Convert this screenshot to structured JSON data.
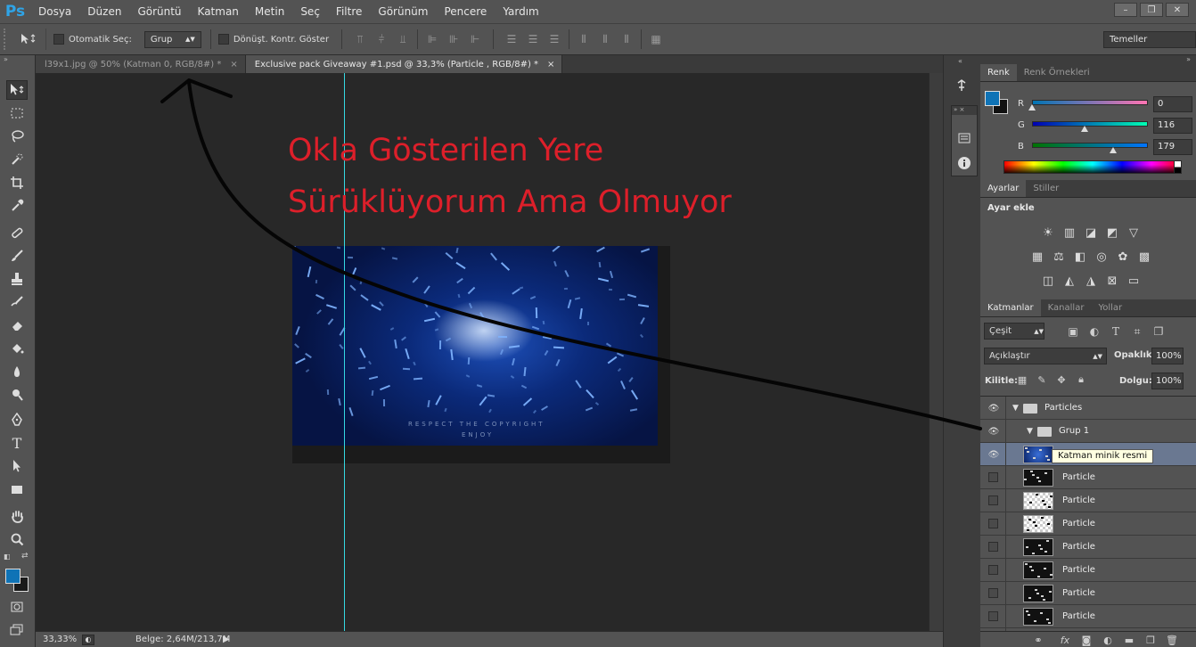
{
  "app": {
    "logo": "Ps"
  },
  "menu": [
    "Dosya",
    "Düzen",
    "Görüntü",
    "Katman",
    "Metin",
    "Seç",
    "Filtre",
    "Görünüm",
    "Pencere",
    "Yardım"
  ],
  "window_controls": {
    "minimize": "–",
    "restore": "❐",
    "close": "✕"
  },
  "options": {
    "auto_select_label": "Otomatik Seç:",
    "auto_select_target": "Grup",
    "show_transform_label": "Dönüşt. Kontr. Göster",
    "workspace": "Temeller"
  },
  "tabs": [
    {
      "label": "l39x1.jpg @ 50% (Katman 0, RGB/8#) *",
      "close": "×"
    },
    {
      "label": "Exclusive pack Giveaway #1.psd @ 33,3% (Particle , RGB/8#) *",
      "close": "×"
    }
  ],
  "annotation": {
    "line1": "Okla Gösterilen  Yere",
    "line2": "Sürüklüyorum Ama Olmuyor",
    "color": "#dd1f2a"
  },
  "document_image": {
    "text1": "RESPECT THE COPYRIGHT",
    "text2": "ENJOY"
  },
  "status": {
    "zoom": "33,33%",
    "doc_info": "Belge: 2,64M/213,7M"
  },
  "colors": {
    "foreground": "#0f73b6",
    "background": "#111111",
    "guide": "#35d9e3"
  },
  "color_panel": {
    "tabs": [
      "Renk",
      "Renk Örnekleri"
    ],
    "r_label": "R",
    "g_label": "G",
    "b_label": "B",
    "r": 0,
    "g": 116,
    "b": 179
  },
  "adjustments": {
    "tabs": [
      "Ayarlar",
      "Stiller"
    ],
    "title": "Ayar ekle"
  },
  "layers_panel": {
    "tabs": [
      "Katmanlar",
      "Kanallar",
      "Yollar"
    ],
    "filter": "Çeşit",
    "blend_mode": "Açıklaştır",
    "opacity_label": "Opaklık:",
    "opacity": "100%",
    "lock_label": "Kilitle:",
    "fill_label": "Dolgu:",
    "fill": "100%",
    "tooltip": "Katman minik resmi",
    "footer_link_label": "fx"
  },
  "layers": [
    {
      "name": "Particles",
      "kind": "group",
      "visible": true,
      "level": 0
    },
    {
      "name": "Grup 1",
      "kind": "group",
      "visible": true,
      "level": 1
    },
    {
      "name": "Particle",
      "kind": "layer",
      "visible": true,
      "selected": true
    },
    {
      "name": "Particle",
      "kind": "layer",
      "visible": false
    },
    {
      "name": "Particle",
      "kind": "layer",
      "visible": false
    },
    {
      "name": "Particle",
      "kind": "layer",
      "visible": false
    },
    {
      "name": "Particle",
      "kind": "layer",
      "visible": false
    },
    {
      "name": "Particle",
      "kind": "layer",
      "visible": false
    },
    {
      "name": "Particle",
      "kind": "layer",
      "visible": false
    },
    {
      "name": "Particle",
      "kind": "layer",
      "visible": false
    },
    {
      "name": "Particle",
      "kind": "layer",
      "visible": true
    }
  ],
  "icons": {
    "move": "move-icon",
    "marquee": "marquee-icon",
    "lasso": "lasso-icon",
    "quick-select": "quick-select-icon",
    "crop": "crop-icon",
    "eyedropper": "eyedropper-icon",
    "healing": "healing-brush-icon",
    "brush": "brush-icon",
    "stamp": "clone-stamp-icon",
    "history-brush": "history-brush-icon",
    "eraser": "eraser-icon",
    "bucket": "paint-bucket-icon",
    "blur": "blur-icon",
    "dodge": "dodge-icon",
    "pen": "pen-icon",
    "type": "type-icon",
    "path-select": "path-selection-icon",
    "shape": "rectangle-shape-icon",
    "hand": "hand-icon",
    "zoom": "zoom-icon"
  }
}
